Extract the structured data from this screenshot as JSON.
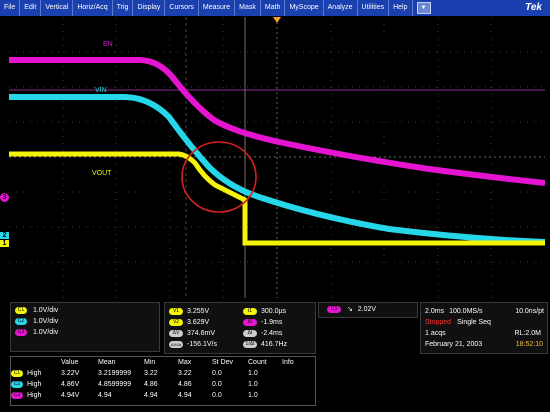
{
  "menu": [
    "File",
    "Edit",
    "Vertical",
    "Horiz/Acq",
    "Trig",
    "Display",
    "Cursors",
    "Measure",
    "Mask",
    "Math",
    "MyScope",
    "Analyze",
    "Utilities",
    "Help"
  ],
  "brand": "Tek",
  "labels": {
    "en": "EN",
    "vin": "VIN",
    "vout": "VOUT"
  },
  "markers": {
    "ch1": "1",
    "ch2": "2",
    "ch3": "3"
  },
  "channels": [
    {
      "id": "C1",
      "scale": "1.0V/div",
      "color": "#f4f40a"
    },
    {
      "id": "C2",
      "scale": "1.0V/div",
      "color": "#25d7e8"
    },
    {
      "id": "C3",
      "scale": "1.0V/div",
      "color": "#e514d0"
    }
  ],
  "cursors": {
    "v1": "3.255V",
    "t1": "300.0µs",
    "v2": "3.629V",
    "t2": "-1.9ms",
    "dv": "374.6mV",
    "dt": "-2.4ms",
    "dvdt": "-156.1V/s",
    "inv_dt": "416.7Hz",
    "v1_tag": "V1",
    "v2_tag": "V2",
    "dv_tag": "ΔV",
    "dvdt_tag": "ΔV/Δt",
    "t1_tag": "t1",
    "t2_tag": "t2",
    "dt_tag": "Δt",
    "inv_tag": "1/Δt"
  },
  "trigger": {
    "channel": "C3",
    "level": "2.02V"
  },
  "acq": {
    "time_div": "2.0ms",
    "sample_rate": "100.0MS/s",
    "per_pt": "10.0ns/pt",
    "state": "Stopped",
    "mode": "Single Seq",
    "acqs": "1 acqs",
    "record_length": "RL:2.0M",
    "date": "February 21, 2003",
    "time": "18:52:10"
  },
  "measurements": {
    "headers": [
      "",
      "Value",
      "Mean",
      "Min",
      "Max",
      "St Dev",
      "Count",
      "Info"
    ],
    "rows": [
      {
        "ch": "C1",
        "name": "High",
        "value": "3.22V",
        "mean": "3.2199999",
        "min": "3.22",
        "max": "3.22",
        "stdev": "0.0",
        "count": "1.0",
        "info": ""
      },
      {
        "ch": "C2",
        "name": "High",
        "value": "4.86V",
        "mean": "4.8599999",
        "min": "4.86",
        "max": "4.86",
        "stdev": "0.0",
        "count": "1.0",
        "info": ""
      },
      {
        "ch": "C3",
        "name": "High",
        "value": "4.94V",
        "mean": "4.94",
        "min": "4.94",
        "max": "4.94",
        "stdev": "0.0",
        "count": "1.0",
        "info": ""
      }
    ]
  },
  "colors": {
    "ch1": "#f4f40a",
    "ch2": "#25d7e8",
    "ch3": "#e514d0",
    "menu": "#1a3fae",
    "annotation_circle": "#d42020",
    "stopped": "#ff3333"
  }
}
